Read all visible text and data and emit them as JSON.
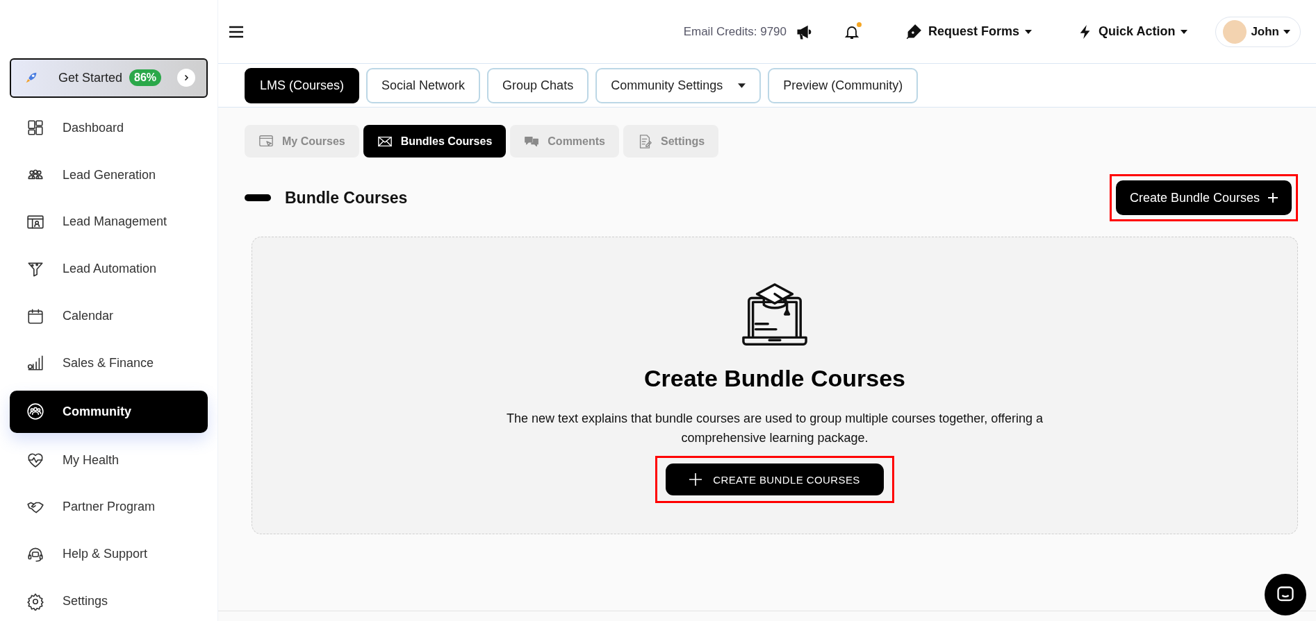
{
  "sidebar": {
    "get_started": {
      "label": "Get Started",
      "badge": "86%"
    },
    "items": [
      {
        "label": "Dashboard",
        "selected": false
      },
      {
        "label": "Lead Generation",
        "selected": false
      },
      {
        "label": "Lead Management",
        "selected": false
      },
      {
        "label": "Lead Automation",
        "selected": false
      },
      {
        "label": "Calendar",
        "selected": false
      },
      {
        "label": "Sales & Finance",
        "selected": false
      },
      {
        "label": "Community",
        "selected": true
      },
      {
        "label": "My Health",
        "selected": false
      },
      {
        "label": "Partner Program",
        "selected": false
      },
      {
        "label": "Help & Support",
        "selected": false
      },
      {
        "label": "Settings",
        "selected": false
      }
    ]
  },
  "topbar": {
    "email_credits": "Email Credits: 9790",
    "request_forms": "Request Forms",
    "quick_action": "Quick Action",
    "user": "John"
  },
  "tabs": [
    {
      "label": "LMS (Courses)",
      "selected": true,
      "kind": "plain"
    },
    {
      "label": "Social Network",
      "selected": false,
      "kind": "plain"
    },
    {
      "label": "Group Chats",
      "selected": false,
      "kind": "plain"
    },
    {
      "label": "Community Settings",
      "selected": false,
      "kind": "dropdown"
    },
    {
      "label": "Preview (Community)",
      "selected": false,
      "kind": "plain"
    }
  ],
  "subtabs": [
    {
      "label": "My Courses",
      "selected": false
    },
    {
      "label": "Bundles Courses",
      "selected": true
    },
    {
      "label": "Comments",
      "selected": false
    },
    {
      "label": "Settings",
      "selected": false
    }
  ],
  "section": {
    "title": "Bundle Courses",
    "create_button": {
      "label": "Create Bundle Courses",
      "highlighted": true
    }
  },
  "empty_state": {
    "title": "Create Bundle Courses",
    "description": "The new text explains that bundle courses are used to group multiple courses together, offering a comprehensive learning package.",
    "button": {
      "label": "CREATE BUNDLE COURSES",
      "highlighted": true
    }
  }
}
